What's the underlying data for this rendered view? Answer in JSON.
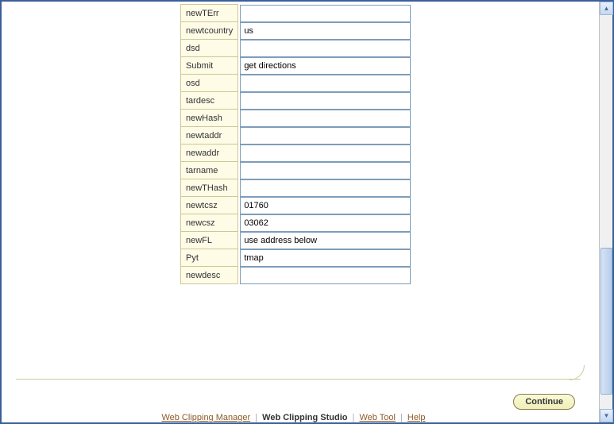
{
  "fields": [
    {
      "label": "newTErr",
      "value": ""
    },
    {
      "label": "newtcountry",
      "value": "us"
    },
    {
      "label": "dsd",
      "value": ""
    },
    {
      "label": "Submit",
      "value": "get directions"
    },
    {
      "label": "osd",
      "value": ""
    },
    {
      "label": "tardesc",
      "value": ""
    },
    {
      "label": "newHash",
      "value": ""
    },
    {
      "label": "newtaddr",
      "value": ""
    },
    {
      "label": "newaddr",
      "value": ""
    },
    {
      "label": "tarname",
      "value": ""
    },
    {
      "label": "newTHash",
      "value": ""
    },
    {
      "label": "newtcsz",
      "value": "01760"
    },
    {
      "label": "newcsz",
      "value": "03062"
    },
    {
      "label": "newFL",
      "value": "use address below"
    },
    {
      "label": "Pyt",
      "value": "tmap"
    },
    {
      "label": "newdesc",
      "value": ""
    }
  ],
  "footer": {
    "link_manager": "Web Clipping Manager",
    "link_studio": "Web Clipping Studio",
    "link_tool": "Web Tool",
    "link_help": "Help"
  },
  "continue_label": "Continue"
}
